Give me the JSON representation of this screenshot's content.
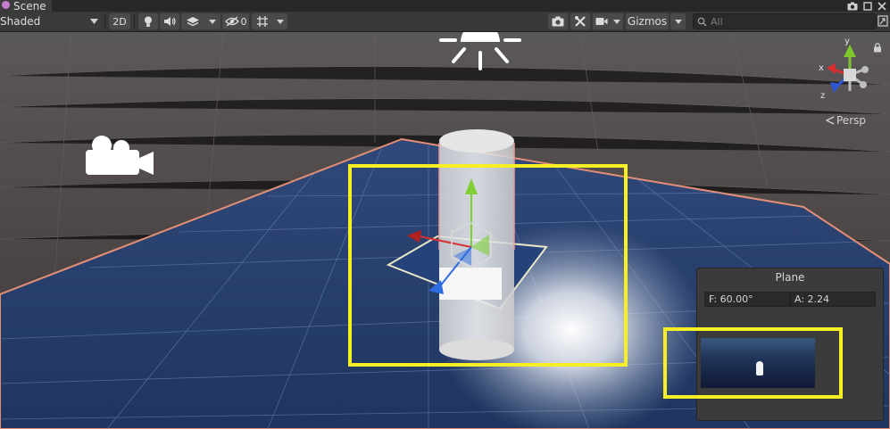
{
  "window": {
    "tab_title": "Scene",
    "tab_icon": "scene-icon",
    "controls": [
      "camera-icon",
      "maximize-icon",
      "close-icon"
    ]
  },
  "toolbar": {
    "draw_mode": "Shaded",
    "mode_2d_label": "2D",
    "hidden_count": "0",
    "gizmos_label": "Gizmos",
    "search_placeholder": "All",
    "icons": [
      "lighting-icon",
      "audio-icon",
      "effects-icon",
      "visibility-icon",
      "grid-icon",
      "screenshot-camera-icon",
      "tools-icon",
      "scene-camera-icon"
    ]
  },
  "orientation_gizmo": {
    "x_label": "x",
    "y_label": "y",
    "z_label": "z",
    "projection_label": "Persp",
    "colors": {
      "x": "#d62e2e",
      "y": "#7fc72b",
      "z": "#2e57d6"
    }
  },
  "camera_overlay": {
    "title": "Plane",
    "fov": "F: 60.00°",
    "aspect": "A: 2.24"
  },
  "highlight_color": "#f5ef23",
  "colors": {
    "toolbar_bg": "#383838",
    "ground_plane": "#26416f",
    "background": "#4a4546"
  }
}
